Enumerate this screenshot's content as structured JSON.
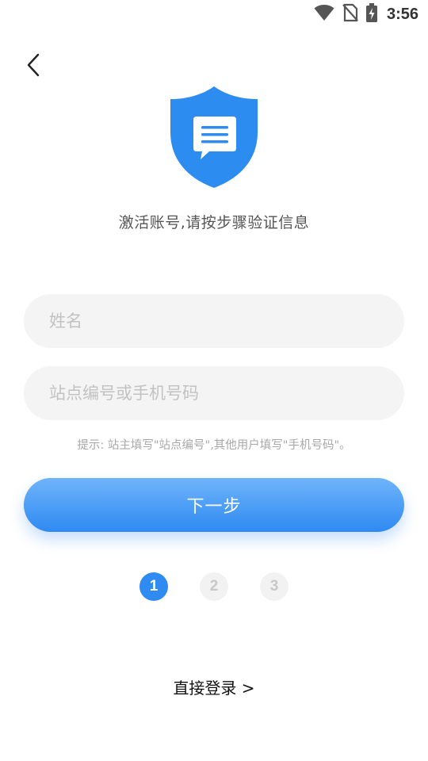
{
  "status_bar": {
    "time": "3:56",
    "icons": [
      "wifi-icon",
      "no-sim-icon",
      "battery-charging-icon"
    ]
  },
  "header": {
    "back_icon": "chevron-left-icon"
  },
  "hero": {
    "icon": "shield-message-icon",
    "subtitle": "激活账号,请按步骤验证信息"
  },
  "form": {
    "name_placeholder": "姓名",
    "name_value": "",
    "account_placeholder": "站点编号或手机号码",
    "account_value": "",
    "hint": "提示: 站主填写\"站点编号\",其他用户填写\"手机号码\"。"
  },
  "next_button": {
    "label": "下一步"
  },
  "steps": {
    "items": [
      "1",
      "2",
      "3"
    ],
    "active_index": 0
  },
  "footer": {
    "login_link": "直接登录 >"
  },
  "colors": {
    "accent": "#2f8af1",
    "shield": "#2d8cf0",
    "input_bg": "#f4f4f4",
    "placeholder": "#c2c2c2"
  }
}
